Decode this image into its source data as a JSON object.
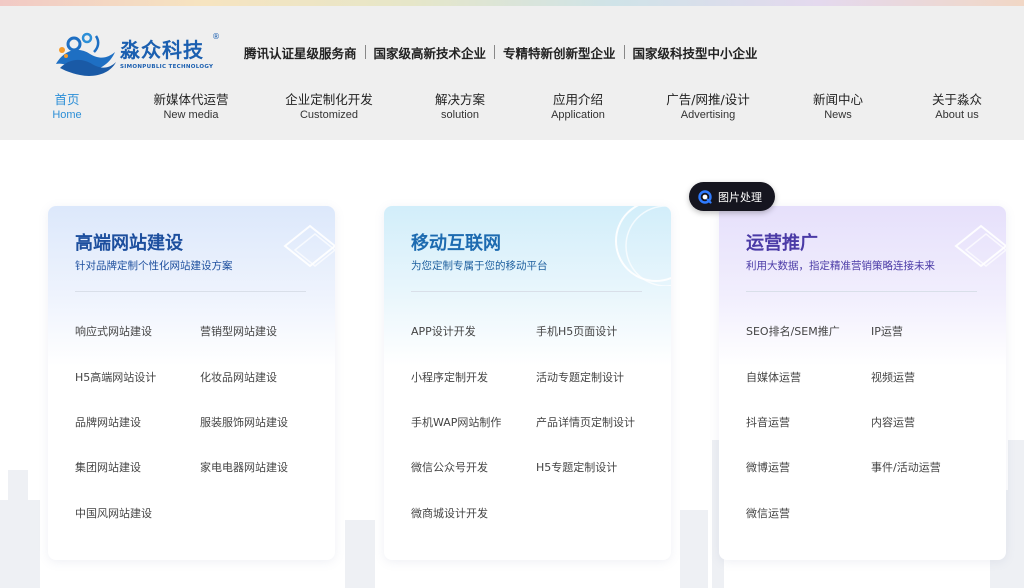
{
  "brand": {
    "name": "淼众科技",
    "registered_mark": "®",
    "english_name": "SIMONPUBLIC TECHNOLOGY"
  },
  "badges": [
    "腾讯认证星级服务商",
    "国家级高新技术企业",
    "专精特新创新型企业",
    "国家级科技型中小企业"
  ],
  "nav": [
    {
      "cn": "首页",
      "en": "Home",
      "active": true
    },
    {
      "cn": "新媒体代运营",
      "en": "New media"
    },
    {
      "cn": "企业定制化开发",
      "en": "Customized"
    },
    {
      "cn": "解决方案",
      "en": "solution"
    },
    {
      "cn": "应用介绍",
      "en": "Application"
    },
    {
      "cn": "广告/网推/设计",
      "en": "Advertising"
    },
    {
      "cn": "新闻中心",
      "en": "News"
    },
    {
      "cn": "关于淼众",
      "en": "About us"
    }
  ],
  "cards": [
    {
      "title": "高端网站建设",
      "subtitle": "针对品牌定制个性化网站建设方案",
      "items": [
        "响应式网站建设",
        "营销型网站建设",
        "H5高端网站设计",
        "化妆品网站建设",
        "品牌网站建设",
        "服装服饰网站建设",
        "集团网站建设",
        "家电电器网站建设",
        "中国风网站建设"
      ]
    },
    {
      "title": "移动互联网",
      "subtitle": "为您定制专属于您的移动平台",
      "items": [
        "APP设计开发",
        "手机H5页面设计",
        "小程序定制开发",
        "活动专题定制设计",
        "手机WAP网站制作",
        "产品详情页定制设计",
        "微信公众号开发",
        "H5专题定制设计",
        "微商城设计开发"
      ]
    },
    {
      "title": "运营推广",
      "subtitle": "利用大数据，指定精准营销策略连接未来",
      "items": [
        "SEO排名/SEM推广",
        "IP运营",
        "自媒体运营",
        "视频运营",
        "抖音运营",
        "内容运营",
        "微博运营",
        "事件/活动运营",
        "微信运营"
      ]
    }
  ],
  "tooltip": {
    "label": "图片处理",
    "icon": "q-logo-icon"
  },
  "colors": {
    "header_bg": "#efefef",
    "nav_active": "#2d8fd7",
    "title_blue": "#1d4f9e",
    "title_purple": "#4a3aa6",
    "tooltip_bg": "#15151f"
  }
}
